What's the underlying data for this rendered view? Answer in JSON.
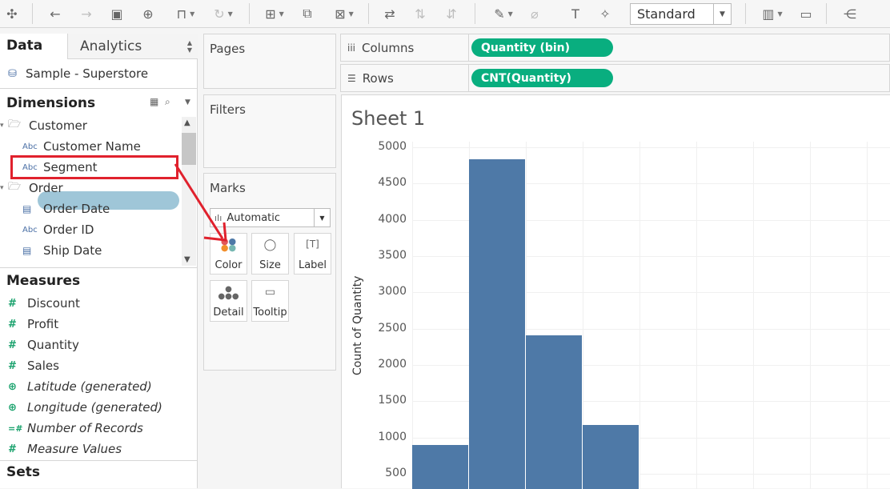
{
  "toolbar": {
    "fit_select": "Standard"
  },
  "data_pane": {
    "tab_data": "Data",
    "tab_analytics": "Analytics",
    "datasource": "Sample - Superstore",
    "dimensions_title": "Dimensions",
    "dimensions": [
      {
        "label": "Customer",
        "type": "folder"
      },
      {
        "label": "Customer Name",
        "type": "Abc"
      },
      {
        "label": "Segment",
        "type": "Abc"
      },
      {
        "label": "Order",
        "type": "folder"
      },
      {
        "label": "Order Date",
        "type": "date"
      },
      {
        "label": "Order ID",
        "type": "Abc"
      },
      {
        "label": "Ship Date",
        "type": "date"
      }
    ],
    "abc_icon": "Abc",
    "measures_title": "Measures",
    "measures": [
      {
        "label": "Discount",
        "italic": false,
        "icon": "#"
      },
      {
        "label": "Profit",
        "italic": false,
        "icon": "#"
      },
      {
        "label": "Quantity",
        "italic": false,
        "icon": "#"
      },
      {
        "label": "Sales",
        "italic": false,
        "icon": "#"
      },
      {
        "label": "Latitude (generated)",
        "italic": true,
        "icon": "globe"
      },
      {
        "label": "Longitude (generated)",
        "italic": true,
        "icon": "globe"
      },
      {
        "label": "Number of Records",
        "italic": true,
        "icon": "=#"
      },
      {
        "label": "Measure Values",
        "italic": true,
        "icon": "#"
      }
    ],
    "sets_title": "Sets"
  },
  "cards": {
    "pages": "Pages",
    "filters": "Filters",
    "marks": "Marks",
    "marks_type": "Automatic",
    "mark_buttons": [
      "Color",
      "Size",
      "Label",
      "Detail",
      "Tooltip"
    ]
  },
  "shelves": {
    "columns_label": "Columns",
    "columns_pill": "Quantity (bin)",
    "rows_label": "Rows",
    "rows_pill": "CNT(Quantity)"
  },
  "sheet": {
    "title": "Sheet 1"
  },
  "chart_data": {
    "type": "bar",
    "title": "Sheet 1",
    "ylabel": "Count of Quantity",
    "xlabel": "",
    "yticks": [
      "5000",
      "4500",
      "4000",
      "3500",
      "3000",
      "2500",
      "2000",
      "1500",
      "1000",
      "500"
    ],
    "ylim": [
      400,
      5000
    ],
    "values": [
      900,
      4830,
      2410,
      1170
    ]
  },
  "colors": {
    "bar": "#4e79a7",
    "pill": "#09ae7f",
    "highlight": "#9fc6d8",
    "annotation": "#e0212d"
  }
}
